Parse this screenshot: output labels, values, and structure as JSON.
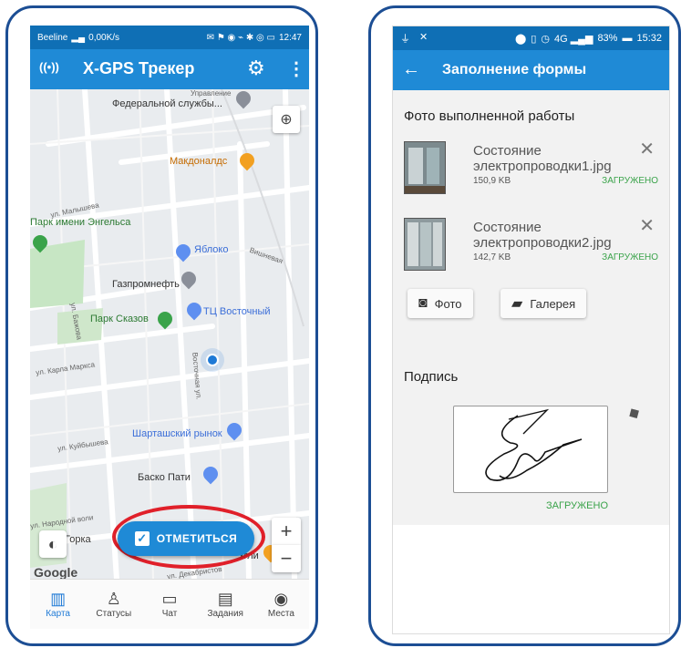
{
  "left_phone": {
    "status_bar": {
      "carrier": "Beeline",
      "speed": "0,00K/s",
      "time": "12:47"
    },
    "app_bar": {
      "title": "X-GPS Трекер",
      "icons": [
        "broadcast-icon",
        "gear-icon",
        "more-vert-icon"
      ]
    },
    "map": {
      "labels": {
        "federal": "Федеральной службы...",
        "upravlenie": "Управление",
        "mcdonalds": "Макдоналдс",
        "malysheva": "ул. Малышева",
        "park_engelsa": "Парк имени Энгельса",
        "yabloko": "Яблоко",
        "vishnevaya": "Вишневая",
        "gazpromneft": "Газпромнефть",
        "bazhova": "ул. Бажова",
        "park_skazov": "Парк Сказов",
        "tc_vostochny": "ТЦ Восточный",
        "karla_marksa": "ул. Карла Маркса",
        "vostochnaya": "Восточная ул.",
        "sharta_market": "Шарташский рынок",
        "kuibysheva": "ул. Куйбышева",
        "basko": "Баско Пати",
        "narodnoi_voli": "ул. Народной воли",
        "gorka": "Горка",
        "ugli": "Угли",
        "dekabristov": "ул. Декабристов",
        "google": "Google"
      },
      "checkin_button": "ОТМЕТИТЬСЯ",
      "zoom_in": "+",
      "zoom_out": "−"
    },
    "bottom_nav": [
      {
        "label": "Карта",
        "icon": "map-icon",
        "active": true
      },
      {
        "label": "Статусы",
        "icon": "status-icon",
        "active": false
      },
      {
        "label": "Чат",
        "icon": "chat-icon",
        "active": false
      },
      {
        "label": "Задания",
        "icon": "clipboard-icon",
        "active": false
      },
      {
        "label": "Места",
        "icon": "place-icon",
        "active": false
      }
    ]
  },
  "right_phone": {
    "status_bar": {
      "battery": "83%",
      "time": "15:32"
    },
    "app_bar": {
      "title": "Заполнение формы"
    },
    "form": {
      "photo_section_title": "Фото выполненной работы",
      "files": [
        {
          "name_line1": "Состояние",
          "name_line2": "электропроводки1.jpg",
          "size": "150,9 KB",
          "status": "ЗАГРУЖЕНО"
        },
        {
          "name_line1": "Состояние",
          "name_line2": "электропроводки2.jpg",
          "size": "142,7 KB",
          "status": "ЗАГРУЖЕНО"
        }
      ],
      "photo_button": "Фото",
      "gallery_button": "Галерея",
      "signature_title": "Подпись",
      "signature_status": "ЗАГРУЖЕНО"
    }
  },
  "colors": {
    "frame": "#1c4e94",
    "status_bar": "#0f6fb5",
    "app_bar": "#1f8ad6",
    "success": "#3aa34a",
    "checkin_button": "#1f8ad6",
    "highlight_circle": "#e0202a"
  }
}
